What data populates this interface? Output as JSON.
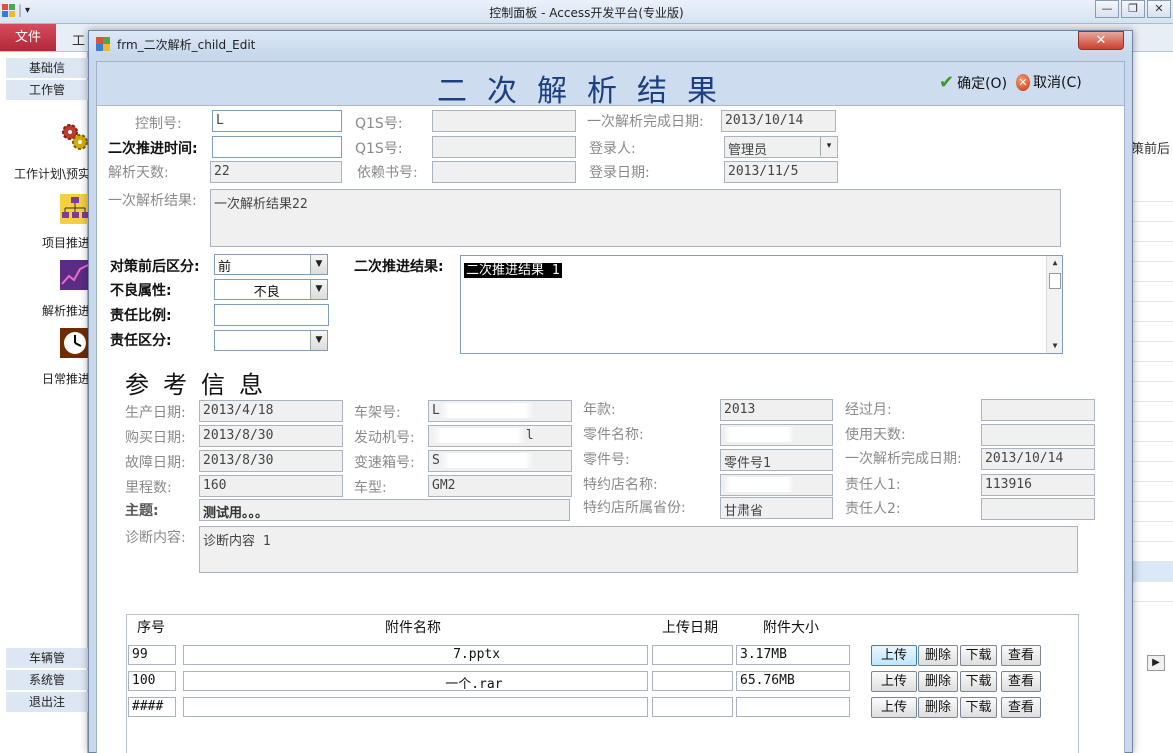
{
  "app": {
    "title": "控制面板 - Access开发平台(专业版)",
    "file_tab": "文件",
    "ribbon_tab2": "工",
    "window_buttons": [
      "—",
      "❐",
      "✕"
    ]
  },
  "nav": {
    "headers_top": [
      "基础信",
      "工作管"
    ],
    "items": [
      {
        "label": "工作计划\\预实",
        "icon": "gears-icon"
      },
      {
        "label": "项目推进",
        "icon": "org-chart-icon"
      },
      {
        "label": "解析推进",
        "icon": "chart-icon"
      },
      {
        "label": "日常推进",
        "icon": "clock-icon"
      }
    ],
    "headers_bottom": [
      "车辆管",
      "系统管",
      "退出注"
    ]
  },
  "right_pane": {
    "header_fragment": "策前后"
  },
  "dialog": {
    "title": "frm_二次解析_child_Edit",
    "close_glyph": "✕",
    "heading": "二次解析结果",
    "ok_label": "确定(O)",
    "cancel_label": "取消(C)",
    "ok_icon": "checkmark-icon",
    "cancel_icon": "cancel-icon"
  },
  "fields": {
    "control_no": {
      "label": "控制号:",
      "value": "L"
    },
    "q1": {
      "label": "Q1S号:",
      "value": ""
    },
    "first_done_date": {
      "label": "一次解析完成日期:",
      "value": "2013/10/14"
    },
    "second_push_time": {
      "label": "二次推进时间:",
      "value": ""
    },
    "q2": {
      "label": "Q1S号:",
      "value": ""
    },
    "registrar": {
      "label": "登录人:",
      "value": "管理员"
    },
    "days": {
      "label": "解析天数:",
      "value": "22"
    },
    "basis_no": {
      "label": "依赖书号:",
      "value": ""
    },
    "reg_date": {
      "label": "登录日期:",
      "value": "2013/11/5"
    },
    "first_result": {
      "label": "一次解析结果:",
      "value": "一次解析结果22"
    },
    "before_after": {
      "label": "对策前后区分:",
      "value": "前"
    },
    "defect_attr": {
      "label": "不良属性:",
      "value": "不良"
    },
    "resp_ratio": {
      "label": "责任比例:",
      "value": ""
    },
    "resp_class": {
      "label": "责任区分:",
      "value": ""
    },
    "second_result": {
      "label": "二次推进结果:",
      "value": "二次推进结果 1"
    }
  },
  "reference": {
    "title": "参考信息",
    "production_date": {
      "label": "生产日期:",
      "value": "2013/4/18"
    },
    "purchase_date": {
      "label": "购买日期:",
      "value": "2013/8/30"
    },
    "failure_date": {
      "label": "故障日期:",
      "value": "2013/8/30"
    },
    "mileage": {
      "label": "里程数:",
      "value": "160"
    },
    "subject": {
      "label": "主题:",
      "value": "测试用。。。"
    },
    "diagnosis": {
      "label": "诊断内容:",
      "value": "诊断内容 1"
    },
    "vin": {
      "label": "车架号:",
      "value": "L"
    },
    "engine_no": {
      "label": "发动机号:",
      "value": "l"
    },
    "trans_no": {
      "label": "变速箱号:",
      "value": "S"
    },
    "model": {
      "label": "车型:",
      "value": "GM2"
    },
    "year": {
      "label": "年款:",
      "value": "2013"
    },
    "part_name": {
      "label": "零件名称:",
      "value": ""
    },
    "part_no": {
      "label": "零件号:",
      "value": "零件号1"
    },
    "dealer": {
      "label": "特约店名称:",
      "value": ""
    },
    "dealer_prov": {
      "label": "特约店所属省份:",
      "value": "甘肃省"
    },
    "months": {
      "label": "经过月:",
      "value": ""
    },
    "use_days": {
      "label": "使用天数:",
      "value": ""
    },
    "first_done": {
      "label": "一次解析完成日期:",
      "value": "2013/10/14"
    },
    "owner1": {
      "label": "责任人1:",
      "value": "113916"
    },
    "owner2": {
      "label": "责任人2:",
      "value": ""
    }
  },
  "attachments": {
    "headers": [
      "序号",
      "附件名称",
      "上传日期",
      "附件大小"
    ],
    "rows": [
      {
        "no": "99",
        "name": "7.pptx",
        "date": "",
        "size": "3.17MB"
      },
      {
        "no": "100",
        "name": "一个.rar",
        "date": "",
        "size": "65.76MB"
      },
      {
        "no": "####",
        "name": "",
        "date": "",
        "size": ""
      }
    ],
    "buttons": [
      "上传",
      "删除",
      "下载",
      "查看"
    ]
  }
}
